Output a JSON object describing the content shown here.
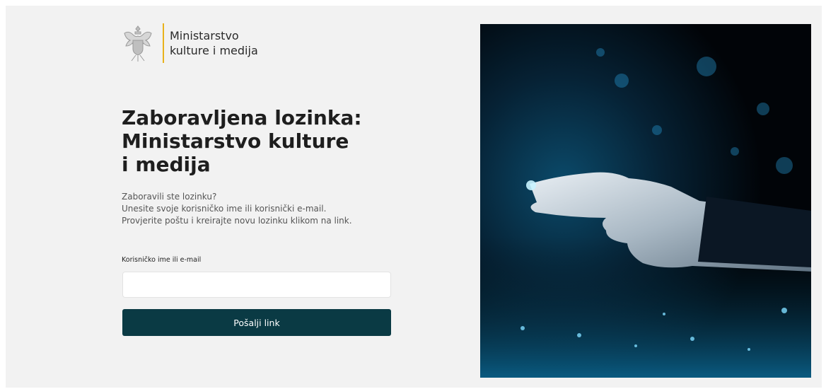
{
  "branding": {
    "logo_line1": "Ministarstvo",
    "logo_line2": "kulture i medija",
    "accent": "#e8b21c",
    "crest_icon": "coat-of-arms-icon"
  },
  "heading": {
    "line1": "Zaboravljena lozinka:",
    "line2": "Ministarstvo kulture",
    "line3": "i medija"
  },
  "intro": {
    "line1": "Zaboravili ste lozinku?",
    "line2": "Unesite svoje korisničko ime ili korisnički e-mail.",
    "line3": "Provjerite poštu i kreirajte novu lozinku klikom na link."
  },
  "form": {
    "username_label": "Korisničko ime ili e-mail",
    "username_value": "",
    "submit_label": "Pošalji link",
    "submit_color": "#0a3a44"
  },
  "hero_image": {
    "subject": "hand-touching-digital-data-icon"
  }
}
